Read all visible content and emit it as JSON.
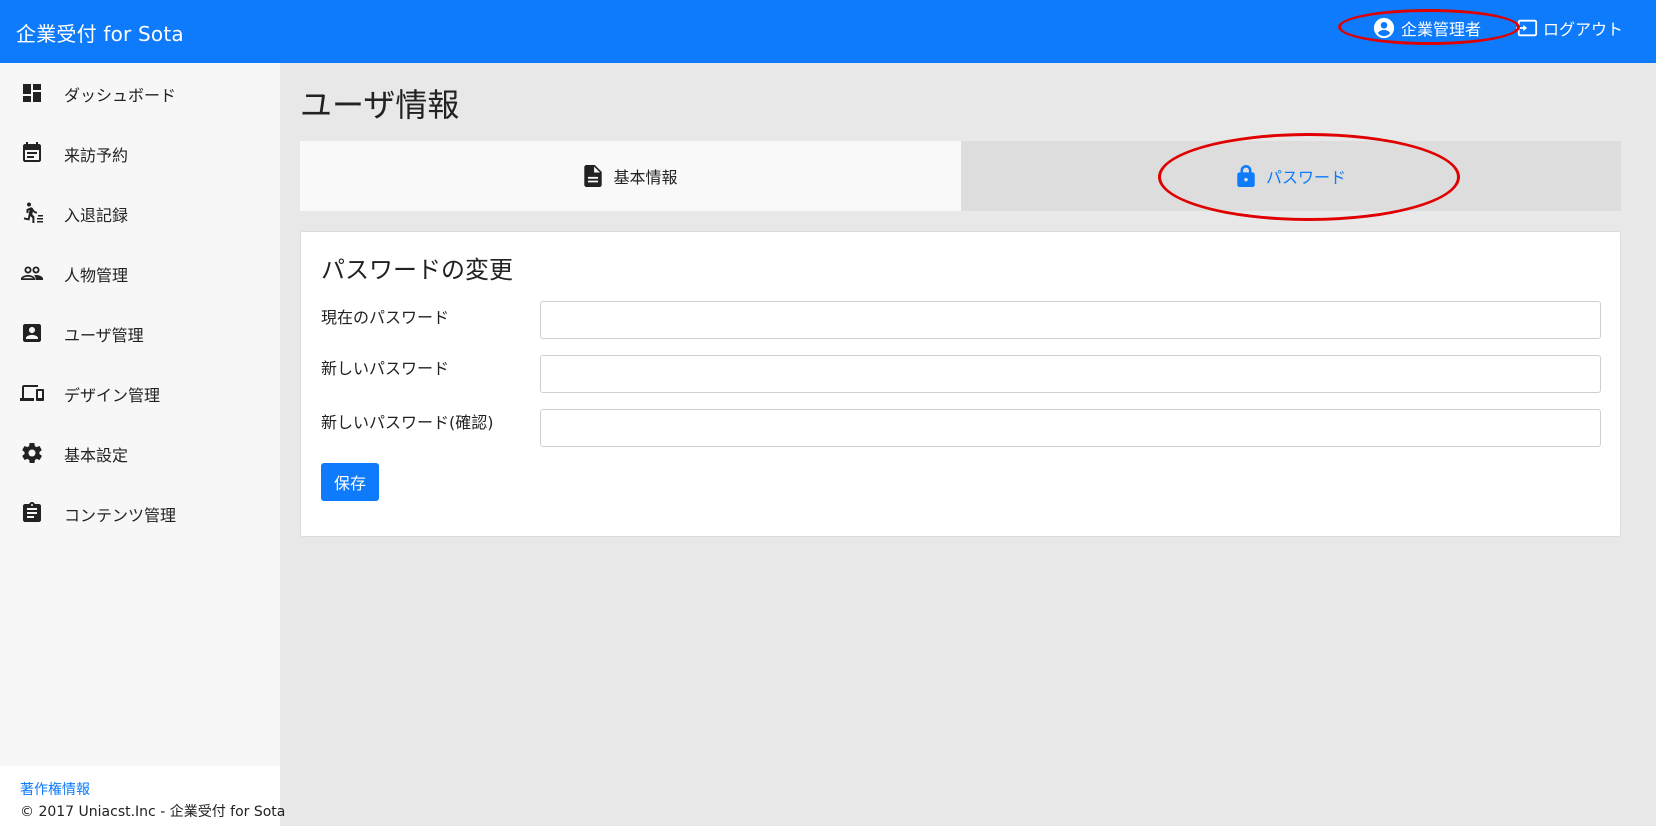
{
  "header": {
    "brand": "企業受付 for Sota",
    "user_name": "企業管理者",
    "logout_label": "ログアウト"
  },
  "sidebar": {
    "items": [
      {
        "label": "ダッシュボード",
        "icon": "dashboard-icon"
      },
      {
        "label": "来訪予約",
        "icon": "calendar-icon"
      },
      {
        "label": "入退記録",
        "icon": "walk-icon"
      },
      {
        "label": "人物管理",
        "icon": "people-icon"
      },
      {
        "label": "ユーザ管理",
        "icon": "account-box-icon"
      },
      {
        "label": "デザイン管理",
        "icon": "devices-icon"
      },
      {
        "label": "基本設定",
        "icon": "gear-icon"
      },
      {
        "label": "コンテンツ管理",
        "icon": "clipboard-icon"
      }
    ],
    "footer": {
      "copyright_link": "著作権情報",
      "copyright_text": "© 2017 Uniacst.Inc - 企業受付 for Sota"
    }
  },
  "main": {
    "title": "ユーザ情報",
    "tabs": [
      {
        "label": "基本情報",
        "icon": "document-icon",
        "active": false
      },
      {
        "label": "パスワード",
        "icon": "lock-icon",
        "active": true
      }
    ],
    "form": {
      "title": "パスワードの変更",
      "fields": [
        {
          "label": "現在のパスワード",
          "value": ""
        },
        {
          "label": "新しいパスワード",
          "value": ""
        },
        {
          "label": "新しいパスワード(確認)",
          "value": ""
        }
      ],
      "save_label": "保存"
    }
  },
  "colors": {
    "primary": "#0d7bfb",
    "annotation": "#e00000"
  }
}
